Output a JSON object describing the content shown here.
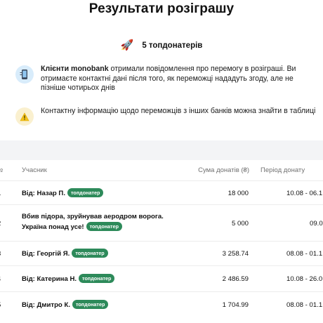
{
  "title": "Результати розіграшу",
  "summary": {
    "icon": "rocket-icon",
    "text": "5 топдонатерів"
  },
  "notices": [
    {
      "icon": "phone-icon",
      "bold": "Клієнти monobank",
      "text": " отримали повідомлення про перемогу в розіграші. Ви отримаєте контактні дані після того, як переможці нададуть згоду, але не пізніше чотирьох днів"
    },
    {
      "icon": "warning-icon",
      "text": "Контактну інформацію щодо переможців з інших банків можна знайти в таблиці"
    }
  ],
  "table": {
    "headers": {
      "no": "№",
      "name": "Учасник",
      "sum": "Сума донатів (₴)",
      "period": "Період донату"
    },
    "badge": "топдонатер",
    "rows": [
      {
        "no": "1",
        "name": "Від: Назар П.",
        "name2": "",
        "sum": "18 000",
        "period": "10.08 - 06.1"
      },
      {
        "no": "2",
        "name": "Вбив підора, зруйнував аеродром ворога.",
        "name2": "Україна понад усе!",
        "sum": "5 000",
        "period": "09.0"
      },
      {
        "no": "3",
        "name": "Від: Георгій Я.",
        "name2": "",
        "sum": "3 258.74",
        "period": "08.08 - 01.1"
      },
      {
        "no": "4",
        "name": "Від: Катерина Н.",
        "name2": "",
        "sum": "2 486.59",
        "period": "10.08 - 26.0"
      },
      {
        "no": "5",
        "name": "Від: Дмитро К.",
        "name2": "",
        "sum": "1 704.99",
        "period": "08.08 - 01.1"
      }
    ]
  }
}
